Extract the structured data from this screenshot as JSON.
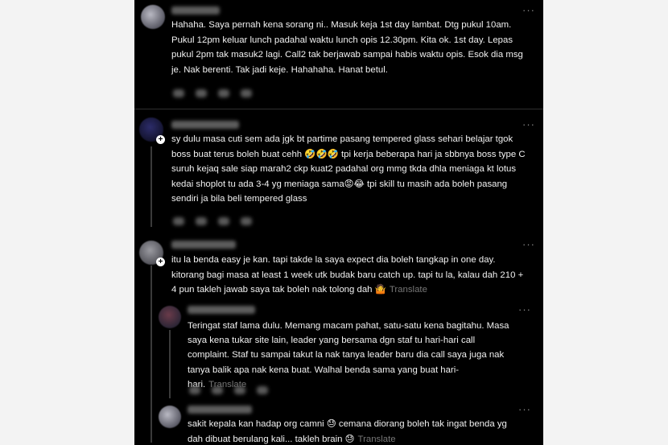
{
  "comments": [
    {
      "text": "Hahaha. Saya pernah kena sorang ni.. Masuk keja 1st day lambat. Dtg pukul 10am. Pukul 12pm keluar lunch padahal waktu lunch opis 12.30pm. Kita ok. 1st day. Lepas pukul 2pm tak masuk2 lagi. Call2 tak berjawab sampai habis waktu opis. Esok dia msg je. Nak berenti. Tak jadi keje. Hahahaha. Hanat betul."
    },
    {
      "text": "sy dulu masa cuti sem ada jgk bt partime pasang tempered glass sehari belajar tgok boss buat terus boleh buat cehh 🤣🤣🤣 tpi kerja beberapa hari ja sbbnya boss type C suruh kejaq sale siap marah2 ckp kuat2 padahal org mmg tkda dhla meniaga kt lotus kedai shoplot tu ada 3-4 yg meniaga sama😡😂 tpi skill tu masih ada boleh pasang sendiri ja bila beli tempered glass"
    },
    {
      "text": "itu la benda easy je kan. tapi takde la saya expect dia boleh tangkap in one day. kitorang bagi masa at least 1 week utk budak baru catch up. tapi tu la, kalau dah 210 + 4 pun takleh jawab saya tak boleh nak tolong dah 🤷",
      "translate": "Translate"
    },
    {
      "text": "Teringat staf lama dulu. Memang macam pahat, satu-satu kena bagitahu. Masa saya kena tukar site lain, leader yang bersama dgn staf tu hari-hari call complaint. Staf tu sampai takut la nak tanya leader baru dia call saya juga nak tanya balik apa nak kena buat. Walhal benda sama yang buat hari-hari.",
      "translate": "Translate"
    },
    {
      "text": "sakit kepala kan hadap org camni 😓 cemana diorang boleh tak ingat benda yg dah dibuat berulang kali... takleh brain 😓",
      "translate": "Translate"
    }
  ],
  "icons": {
    "more": "more-horizontal-icon",
    "follow": "plus-icon"
  },
  "more_glyph": "···",
  "plus_glyph": "+"
}
